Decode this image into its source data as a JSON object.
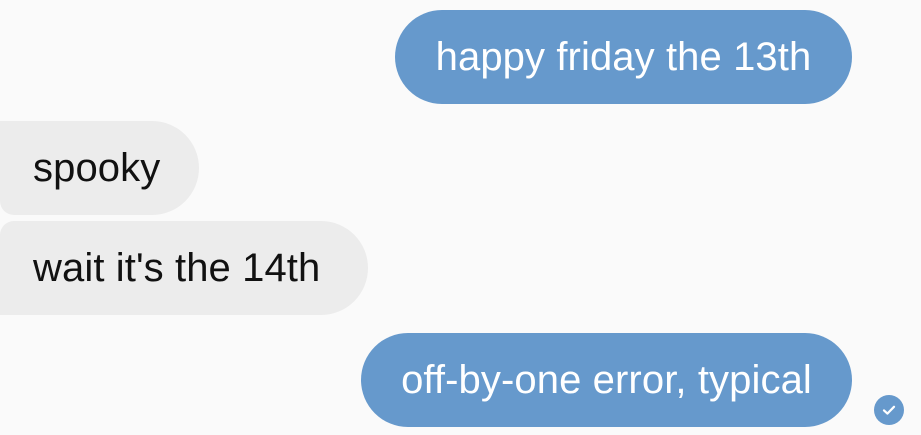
{
  "conversation": {
    "messages": [
      {
        "text": "happy friday the 13th",
        "direction": "outgoing"
      },
      {
        "text": "spooky",
        "direction": "incoming"
      },
      {
        "text": "wait it's the 14th",
        "direction": "incoming"
      },
      {
        "text": "off-by-one error, typical",
        "direction": "outgoing"
      }
    ],
    "last_message_status_icon": "check-circle-icon"
  },
  "colors": {
    "outgoing_bubble": "#6699cc",
    "incoming_bubble": "#ececec",
    "outgoing_text": "#ffffff",
    "incoming_text": "#111111",
    "background": "#fafafa"
  }
}
